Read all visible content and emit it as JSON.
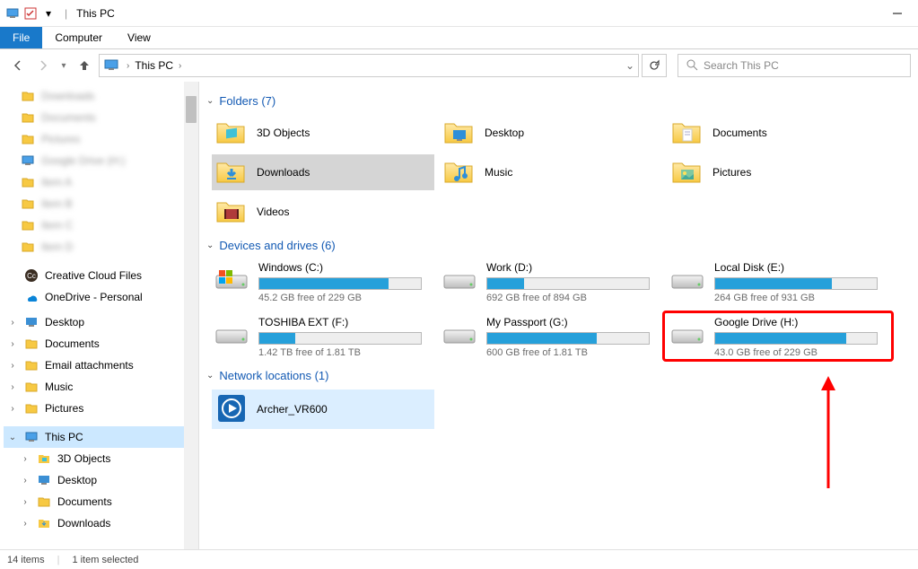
{
  "window": {
    "title": "This PC"
  },
  "ribbon": {
    "file": "File",
    "tabs": [
      "Computer",
      "View"
    ]
  },
  "address": {
    "crumb": "This PC",
    "search_placeholder": "Search This PC"
  },
  "sidebar": {
    "blurred_top": [
      "Downloads",
      "Documents",
      "Pictures",
      "Google Drive (H:)",
      "Item A",
      "Item B",
      "Item C",
      "Item D"
    ],
    "items": [
      {
        "label": "Creative Cloud Files",
        "icon": "cc"
      },
      {
        "label": "OneDrive - Personal",
        "icon": "onedrive"
      },
      {
        "label": "Desktop",
        "icon": "desktop",
        "exp": true
      },
      {
        "label": "Documents",
        "icon": "folder",
        "exp": true
      },
      {
        "label": "Email attachments",
        "icon": "folder",
        "exp": true
      },
      {
        "label": "Music",
        "icon": "folder",
        "exp": true
      },
      {
        "label": "Pictures",
        "icon": "folder",
        "exp": true
      }
    ],
    "this_pc": "This PC",
    "pc_children": [
      {
        "label": "3D Objects",
        "icon": "3d",
        "exp": true
      },
      {
        "label": "Desktop",
        "icon": "desktop",
        "exp": true
      },
      {
        "label": "Documents",
        "icon": "folder",
        "exp": true
      },
      {
        "label": "Downloads",
        "icon": "downloads",
        "exp": true
      }
    ]
  },
  "sections": {
    "folders": {
      "title": "Folders (7)"
    },
    "drives": {
      "title": "Devices and drives (6)"
    },
    "network": {
      "title": "Network locations (1)"
    }
  },
  "folders": [
    {
      "label": "3D Objects",
      "icon": "3d"
    },
    {
      "label": "Desktop",
      "icon": "desktop"
    },
    {
      "label": "Documents",
      "icon": "documents"
    },
    {
      "label": "Downloads",
      "icon": "downloads",
      "selected": true
    },
    {
      "label": "Music",
      "icon": "music"
    },
    {
      "label": "Pictures",
      "icon": "pictures"
    },
    {
      "label": "Videos",
      "icon": "videos"
    }
  ],
  "drives": [
    {
      "name": "Windows (C:)",
      "free": "45.2 GB free of 229 GB",
      "used_pct": 80,
      "icon": "win"
    },
    {
      "name": "Work (D:)",
      "free": "692 GB free of 894 GB",
      "used_pct": 23,
      "icon": "hdd"
    },
    {
      "name": "Local Disk (E:)",
      "free": "264 GB free of 931 GB",
      "used_pct": 72,
      "icon": "hdd"
    },
    {
      "name": "TOSHIBA EXT (F:)",
      "free": "1.42 TB free of 1.81 TB",
      "used_pct": 22,
      "icon": "hdd"
    },
    {
      "name": "My Passport (G:)",
      "free": "600 GB free of 1.81 TB",
      "used_pct": 68,
      "icon": "hdd"
    },
    {
      "name": "Google Drive (H:)",
      "free": "43.0 GB free of 229 GB",
      "used_pct": 81,
      "icon": "hdd",
      "highlight": true
    }
  ],
  "network": [
    {
      "label": "Archer_VR600"
    }
  ],
  "status": {
    "items": "14 items",
    "selected": "1 item selected"
  }
}
